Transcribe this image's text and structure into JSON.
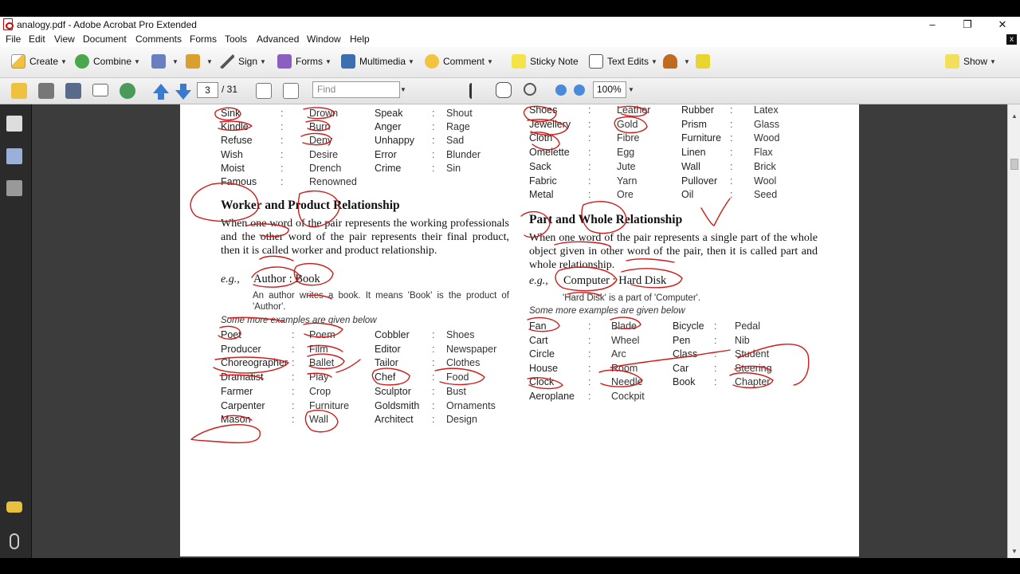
{
  "window": {
    "title": "analogy.pdf - Adobe Acrobat Pro Extended",
    "controls": {
      "minimize": "–",
      "maximize": "❐",
      "close": "✕"
    }
  },
  "menubar": {
    "items": [
      "File",
      "Edit",
      "View",
      "Document",
      "Comments",
      "Forms",
      "Tools",
      "Advanced",
      "Window",
      "Help"
    ],
    "close_label": "x"
  },
  "toolbar": {
    "create": "Create",
    "combine": "Combine",
    "sign": "Sign",
    "forms": "Forms",
    "multimedia": "Multimedia",
    "comment": "Comment",
    "sticky_note": "Sticky Note",
    "text_edits": "Text Edits",
    "show": "Show"
  },
  "navigation": {
    "page_current": "3",
    "page_total": "/ 31",
    "find_placeholder": "Find",
    "zoom": "100%"
  },
  "document": {
    "left": {
      "top_rows": [
        [
          "Sink",
          ":",
          "Drown",
          "Speak",
          ":",
          "Shout"
        ],
        [
          "Kindle",
          ":",
          "Burn",
          "Anger",
          ":",
          "Rage"
        ],
        [
          "Refuse",
          ":",
          "Deny",
          "Unhappy",
          ":",
          "Sad"
        ],
        [
          "Wish",
          ":",
          "Desire",
          "Error",
          ":",
          "Blunder"
        ],
        [
          "Moist",
          ":",
          "Drench",
          "Crime",
          ":",
          "Sin"
        ],
        [
          "Famous",
          ":",
          "Renowned",
          "",
          "",
          ""
        ]
      ],
      "heading": "Worker and Product Relationship",
      "paragraph": "When one word of the pair represents the working professionals and the other word of the pair represents their final product, then it is called worker and product relationship.",
      "eg_label": "e.g.,",
      "eg_pair": "Author : Book",
      "eg_explain": "An author writes a book. It means 'Book' is the product of 'Author'.",
      "more_examples": "Some more examples are given below",
      "example_rows": [
        [
          "Poet",
          ":",
          "Poem",
          "Cobbler",
          ":",
          "Shoes"
        ],
        [
          "Producer",
          ":",
          "Film",
          "Editor",
          ":",
          "Newspaper"
        ],
        [
          "Choreographer",
          ":",
          "Ballet",
          "Tailor",
          ":",
          "Clothes"
        ],
        [
          "Dramatist",
          ":",
          "Play",
          "Chef",
          ":",
          "Food"
        ],
        [
          "Farmer",
          ":",
          "Crop",
          "Sculptor",
          ":",
          "Bust"
        ],
        [
          "Carpenter",
          ":",
          "Furniture",
          "Goldsmith",
          ":",
          "Ornaments"
        ],
        [
          "Mason",
          ":",
          "Wall",
          "Architect",
          ":",
          "Design"
        ]
      ]
    },
    "right": {
      "top_rows": [
        [
          "Shoes",
          ":",
          "Leather",
          "Rubber",
          ":",
          "Latex"
        ],
        [
          "Jewellery",
          ":",
          "Gold",
          "Prism",
          ":",
          "Glass"
        ],
        [
          "Cloth",
          ":",
          "Fibre",
          "Furniture",
          ":",
          "Wood"
        ],
        [
          "Omelette",
          ":",
          "Egg",
          "Linen",
          ":",
          "Flax"
        ],
        [
          "Sack",
          ":",
          "Jute",
          "Wall",
          ":",
          "Brick"
        ],
        [
          "Fabric",
          ":",
          "Yarn",
          "Pullover",
          ":",
          "Wool"
        ],
        [
          "Metal",
          ":",
          "Ore",
          "Oil",
          ":",
          "Seed"
        ]
      ],
      "heading": "Part and Whole Relationship",
      "paragraph": "When one word of the pair represents a single part of the whole object given in other word of the pair, then it is called part and whole relationship.",
      "eg_label": "e.g.,",
      "eg_pair": "Computer : Hard Disk",
      "eg_explain": "'Hard Disk' is a part of 'Computer'.",
      "more_examples": "Some more examples are given below",
      "example_rows": [
        [
          "Fan",
          ":",
          "Blade",
          "Bicycle",
          ":",
          "Pedal"
        ],
        [
          "Cart",
          ":",
          "Wheel",
          "Pen",
          ":",
          "Nib"
        ],
        [
          "Circle",
          ":",
          "Arc",
          "Class",
          ":",
          "Student"
        ],
        [
          "House",
          ":",
          "Room",
          "Car",
          ":",
          "Steering"
        ],
        [
          "Clock",
          ":",
          "Needle",
          "Book",
          ":",
          "Chapter"
        ],
        [
          "Aeroplane",
          ":",
          "Cockpit",
          "",
          "",
          ""
        ]
      ]
    }
  },
  "colors": {
    "ink": "#d11a1a",
    "page": "#ffffff",
    "doc_bg": "#3c3c3c",
    "nav_bg": "#2b2b2b"
  }
}
